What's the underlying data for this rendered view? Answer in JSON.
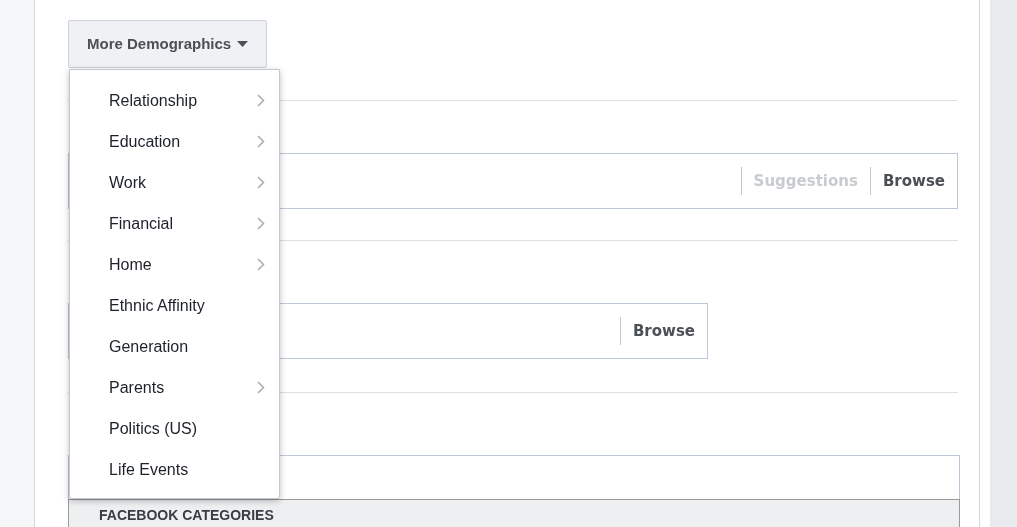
{
  "dropdown_button": {
    "label": "More Demographics",
    "expanded": true
  },
  "menu": {
    "items": [
      {
        "label": "Relationship",
        "submenu": true
      },
      {
        "label": "Education",
        "submenu": true
      },
      {
        "label": "Work",
        "submenu": true
      },
      {
        "label": "Financial",
        "submenu": true
      },
      {
        "label": "Home",
        "submenu": true
      },
      {
        "label": "Ethnic Affinity",
        "submenu": false
      },
      {
        "label": "Generation",
        "submenu": false
      },
      {
        "label": "Parents",
        "submenu": true
      },
      {
        "label": "Politics (US)",
        "submenu": false
      },
      {
        "label": "Life Events",
        "submenu": false
      }
    ]
  },
  "fields": [
    {
      "actions": [
        {
          "label": "Suggestions",
          "disabled": true
        },
        {
          "label": "Browse",
          "disabled": false
        }
      ],
      "wide": true
    },
    {
      "actions": [
        {
          "label": "Browse",
          "disabled": false
        }
      ],
      "wide": false
    }
  ],
  "categories_header": "FACEBOOK CATEGORIES"
}
